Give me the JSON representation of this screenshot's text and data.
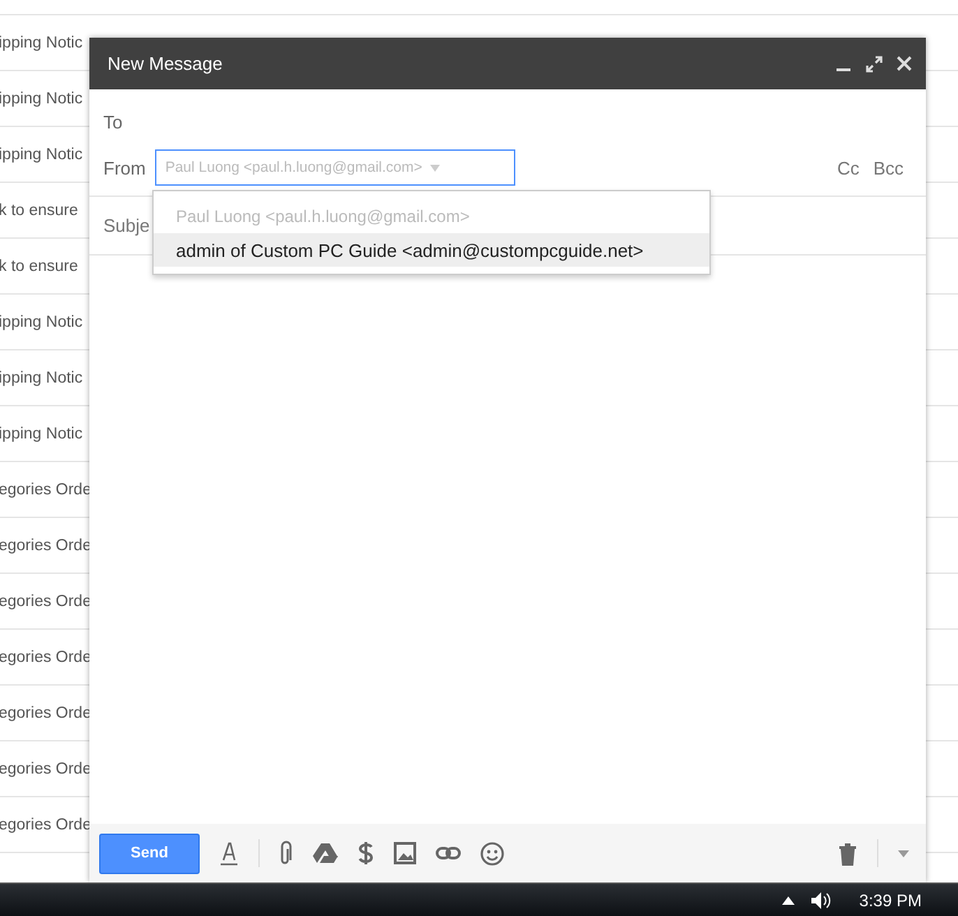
{
  "inbox": {
    "rows": [
      {
        "subject": "ipping Notic"
      },
      {
        "subject": "ipping Notic"
      },
      {
        "subject": "ipping Notic"
      },
      {
        "subject": "k to ensure"
      },
      {
        "subject": "k to ensure"
      },
      {
        "subject": "ipping Notic"
      },
      {
        "subject": "ipping Notic"
      },
      {
        "subject": "ipping Notic"
      },
      {
        "subject": "egories Orde"
      },
      {
        "subject": "egories Orde"
      },
      {
        "subject": "egories Orde"
      },
      {
        "subject": "egories Orde"
      },
      {
        "subject": "egories Orde"
      },
      {
        "subject": "egories Orde"
      },
      {
        "subject": "egories Orde"
      }
    ]
  },
  "compose": {
    "title": "New Message",
    "to_label": "To",
    "from_label": "From",
    "from_value": "Paul Luong <paul.h.luong@gmail.com>",
    "cc": "Cc",
    "bcc": "Bcc",
    "subject_label": "Subje",
    "from_options": [
      {
        "label": "Paul Luong <paul.h.luong@gmail.com>",
        "selected": false
      },
      {
        "label": "admin of Custom PC Guide <admin@custompcguide.net>",
        "selected": true
      }
    ],
    "send_button": "Send"
  },
  "taskbar": {
    "clock": "3:39 PM"
  }
}
